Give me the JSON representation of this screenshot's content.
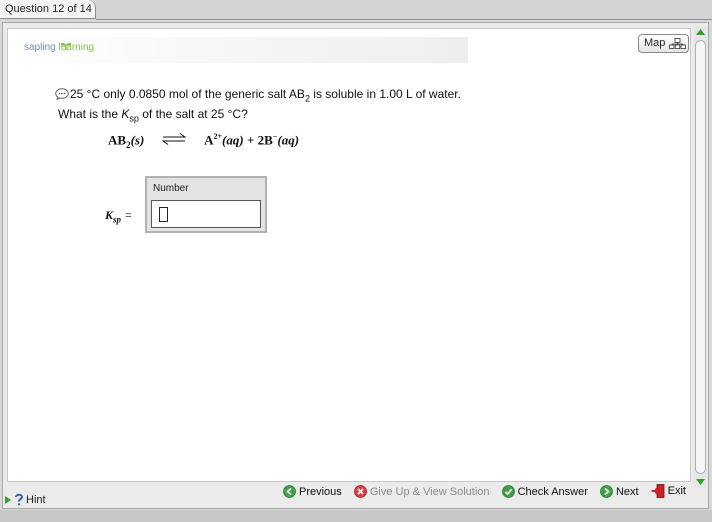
{
  "tab": {
    "label": "Question 12 of 14"
  },
  "logo": {
    "sapling": "sapling",
    "learning": "learning"
  },
  "map_button": {
    "label": "Map"
  },
  "question": {
    "line1_text": "25 °C only 0.0850 mol of the generic salt AB",
    "line1_sub": "2",
    "line1_tail": " is soluble in 1.00 L of water.",
    "line2_pre": "What is the ",
    "line2_k": "K",
    "line2_sub": "sp",
    "line2_post": " of the salt at 25 °C?"
  },
  "equation": {
    "reactant": "AB",
    "reactant_sub": "2",
    "reactant_state": "(s)",
    "product1": "A",
    "product1_charge": "2+",
    "product1_state": "(aq)",
    "plus": "+",
    "product2": "2B",
    "product2_charge": "−",
    "product2_state": "(aq)"
  },
  "answer": {
    "label": "K",
    "label_sub": "sp",
    "equals": "=",
    "header": "Number",
    "value": ""
  },
  "toolbar": {
    "previous": "Previous",
    "give_up": "Give Up & View Solution",
    "check": "Check Answer",
    "next": "Next",
    "exit": "Exit"
  },
  "hint": {
    "label": "Hint"
  },
  "colors": {
    "logo_blue": "#6f8fb2",
    "logo_green": "#8cbe48",
    "accent_green": "#3fa046",
    "exit_red": "#cc2222",
    "scroll_green": "#2fa02f"
  }
}
